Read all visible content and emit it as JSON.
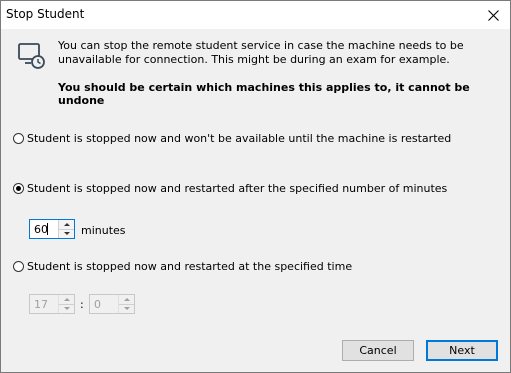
{
  "window": {
    "title": "Stop Student"
  },
  "description": "You can stop the remote student service in case the machine needs to be unavailable for connection. This might be during an exam for example.",
  "warning": "You should be certain which machines this applies to, it cannot be undone",
  "options": [
    {
      "label": "Student is stopped now and won't be available until the machine is restarted",
      "checked": false
    },
    {
      "label": "Student is stopped now and restarted after the specified number of minutes",
      "checked": true
    },
    {
      "label": "Student is stopped now and restarted at the specified time",
      "checked": false
    }
  ],
  "minutes": {
    "value": "60",
    "unit_label": "minutes"
  },
  "time": {
    "hour": "17",
    "separator": ":",
    "minute": "0"
  },
  "buttons": {
    "cancel": "Cancel",
    "next": "Next"
  }
}
